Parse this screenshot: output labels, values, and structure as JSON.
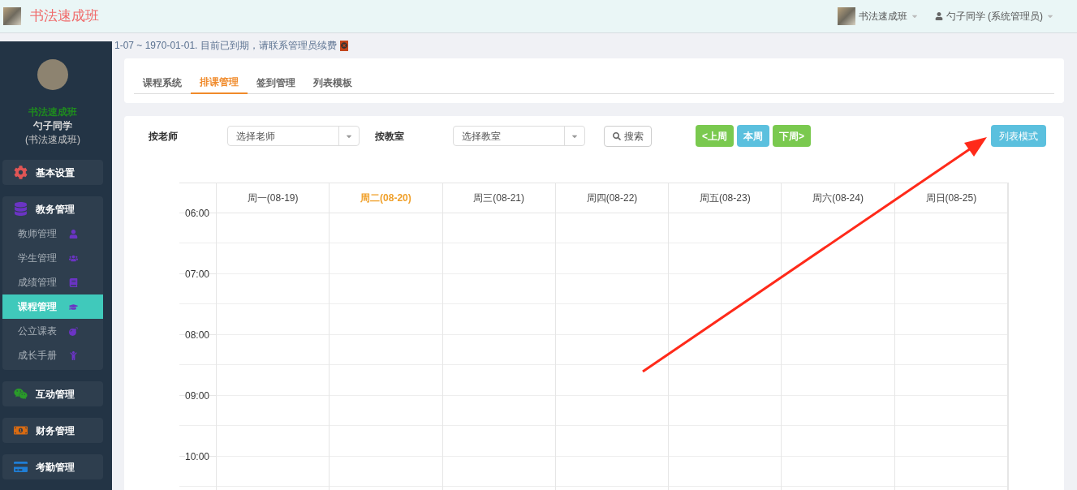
{
  "header": {
    "brand": "书法速成班",
    "school": "书法速成班",
    "user": "勺子同学 (系统管理员)"
  },
  "notice": "1-07 ~ 1970-01-01. 目前已到期，请联系管理员续费",
  "sidebar": {
    "school": "书法速成班",
    "user": "勺子同学",
    "org": "(书法速成班)",
    "menu": [
      {
        "label": "基本设置",
        "kind": "single"
      },
      {
        "label": "教务管理",
        "kind": "group",
        "children": [
          {
            "label": "教师管理",
            "selected": false
          },
          {
            "label": "学生管理",
            "selected": false
          },
          {
            "label": "成绩管理",
            "selected": false
          },
          {
            "label": "课程管理",
            "selected": true
          },
          {
            "label": "公立课表",
            "selected": false
          },
          {
            "label": "成长手册",
            "selected": false
          }
        ]
      },
      {
        "label": "互动管理",
        "kind": "single"
      },
      {
        "label": "财务管理",
        "kind": "single"
      },
      {
        "label": "考勤管理",
        "kind": "single"
      }
    ]
  },
  "tabs": [
    {
      "label": "课程系统",
      "selected": false
    },
    {
      "label": "排课管理",
      "selected": true
    },
    {
      "label": "签到管理",
      "selected": false
    },
    {
      "label": "列表模板",
      "selected": false
    }
  ],
  "filters": [
    {
      "label": "按老师",
      "placeholder": "选择老师"
    },
    {
      "label": "按教室",
      "placeholder": "选择教室"
    }
  ],
  "search_button": "搜索",
  "week_buttons": [
    {
      "label": "<上周",
      "color": "#7ac94f"
    },
    {
      "label": "本周",
      "color": "#5bc0de"
    },
    {
      "label": "下周>",
      "color": "#7ac94f"
    }
  ],
  "mode_button": "列表模式",
  "calendar": {
    "days": [
      {
        "label": "周一(08-19)",
        "selected": false
      },
      {
        "label": "周二(08-20)",
        "selected": true
      },
      {
        "label": "周三(08-21)",
        "selected": false
      },
      {
        "label": "周四(08-22)",
        "selected": false
      },
      {
        "label": "周五(08-23)",
        "selected": false
      },
      {
        "label": "周六(08-24)",
        "selected": false
      },
      {
        "label": "周日(08-25)",
        "selected": false
      }
    ],
    "hours": [
      "06:00",
      "07:00",
      "08:00",
      "09:00",
      "10:00"
    ]
  }
}
